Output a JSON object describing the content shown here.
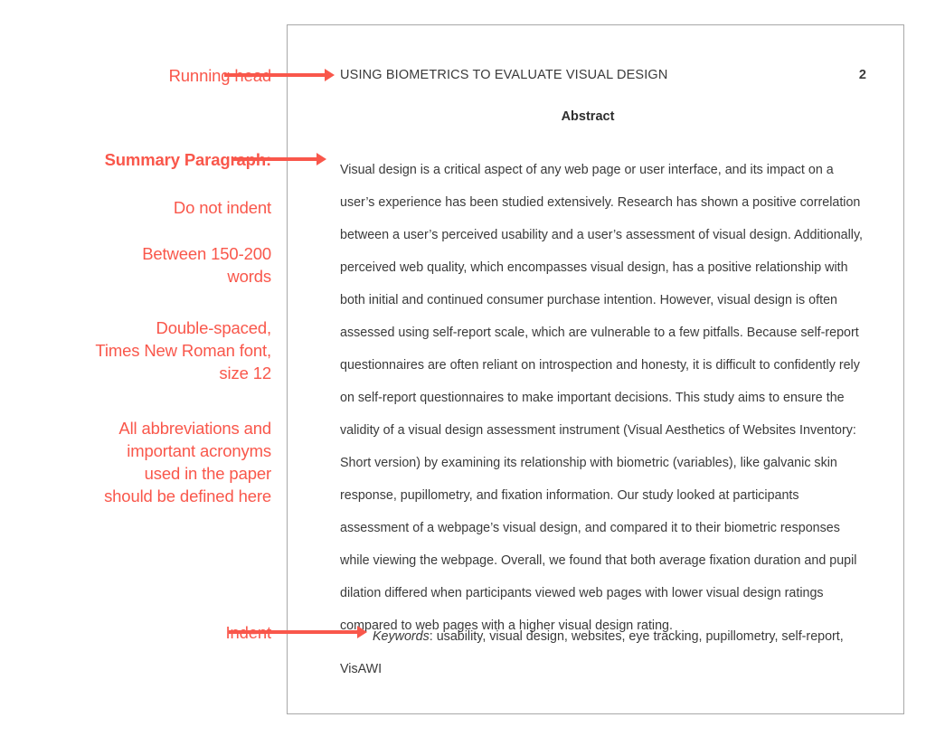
{
  "accent_color": "#F9574B",
  "annotations": [
    {
      "id": "running-head",
      "text": "Running head",
      "bold": false
    },
    {
      "id": "summary-paragraph",
      "text": "Summary Paragraph:",
      "bold": true
    },
    {
      "id": "do-not-indent",
      "text": "Do not indent",
      "bold": false
    },
    {
      "id": "word-count",
      "text": "Between 150-200\nwords",
      "bold": false
    },
    {
      "id": "formatting",
      "text": "Double-spaced,\nTimes New Roman font,\nsize 12",
      "bold": false
    },
    {
      "id": "abbreviations",
      "text": "All abbreviations and\nimportant acronyms\nused in the paper\nshould be defined here",
      "bold": false
    },
    {
      "id": "indent",
      "text": "Indent",
      "bold": false
    }
  ],
  "page": {
    "running_head": "USING BIOMETRICS TO EVALUATE VISUAL DESIGN",
    "page_number": "2",
    "abstract_heading": "Abstract",
    "abstract_body": "Visual design is a critical aspect of any web page or user interface, and its impact on a user’s experience has been studied extensively. Research has shown a positive correlation between a user’s perceived usability and a user’s assessment of visual design. Additionally, perceived web quality, which encompasses visual design, has a positive relationship with both initial and continued consumer purchase intention. However, visual design is often assessed using self-report scale, which are vulnerable to a few pitfalls. Because self-report questionnaires are often reliant on introspection and honesty, it is difficult to confidently rely on self-report questionnaires to make important decisions. This study aims to ensure the validity of a visual design assessment instrument (Visual Aesthetics of Websites Inventory: Short version) by examining its relationship with biometric (variables), like galvanic skin response, pupillometry, and fixation information. Our study looked at participants assessment of a webpage’s visual design, and compared it to their biometric responses while viewing the webpage. Overall, we found that both average fixation duration and pupil dilation differed when participants viewed web pages with lower visual design ratings compared to web pages with a higher visual design rating.",
    "keywords_label": "Keywords",
    "keywords_separator": ": ",
    "keywords_list": "usability, visual design, websites, eye tracking, pupillometry, self-report, VisAWI"
  }
}
